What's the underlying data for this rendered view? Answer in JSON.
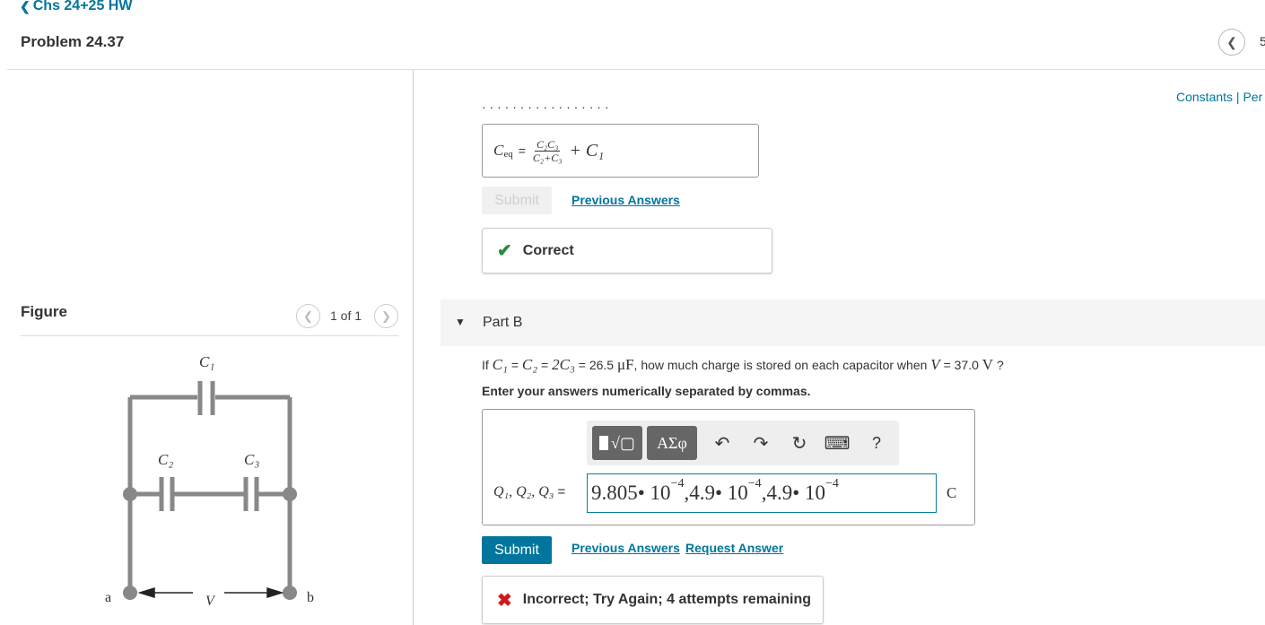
{
  "header": {
    "back_label": "Chs 24+25 HW",
    "problem_title": "Problem 24.37",
    "nav_next_partial": "5"
  },
  "constants": {
    "label": "Constants | Per"
  },
  "part_a": {
    "cut_text": "·  ·  ·  ·     ·  ·     ·  ·     ·  ·  ·  ·  ·  ·  ·  ·  ·",
    "ceq_symbol": "C",
    "ceq_sub": "eq",
    "equals": "=",
    "frac_num": "C₂C₃",
    "frac_den": "C₂+C₃",
    "plus_term": "+ C₁",
    "submit_label": "Submit",
    "previous_answers": "Previous Answers",
    "correct_label": "Correct",
    "colors": {
      "correct": "#2a8a3e"
    }
  },
  "figure": {
    "title": "Figure",
    "count": "1 of 1",
    "labels": {
      "c1": "C₁",
      "c2": "C₂",
      "c3": "C₃",
      "a": "a",
      "b": "b",
      "v": "V"
    }
  },
  "part_b": {
    "title": "Part B",
    "q_prefix": "If",
    "q_c1": "C₁",
    "q_eq1": "=",
    "q_c2": "C₂",
    "q_eq2": "=",
    "q_2c3": "2C₃",
    "q_eq3": "=",
    "q_cap_value": "26.5",
    "q_cap_unit": "μF",
    "q_middle": ", how much charge is stored on each capacitor when",
    "q_v": "V",
    "q_eq4": "=",
    "q_v_value": "37.0",
    "q_v_unit": "V",
    "q_suffix": "?",
    "instructions": "Enter your answers numerically separated by commas.",
    "toolbar": {
      "symbols_label": "ΑΣφ",
      "undo_icon": "↶",
      "redo_icon": "↷",
      "reset_icon": "↻",
      "keyboard_icon": "⌨",
      "help_label": "?"
    },
    "answer_label": "Q₁, Q₂, Q₃",
    "answer_equals": "=",
    "answer": {
      "m1": "9.805",
      "dot1": " • 10",
      "e1": "−4",
      "sep1": ",4.9",
      "dot2": " • 10",
      "e2": "−4",
      "sep2": ",4.9",
      "dot3": " • 10",
      "e3": "−4"
    },
    "unit": "C",
    "submit_label": "Submit",
    "previous_answers": "Previous Answers",
    "request_answer": "Request Answer",
    "feedback": "Incorrect; Try Again; 4 attempts remaining",
    "colors": {
      "submit": "#00759e",
      "incorrect": "#d0181a"
    }
  }
}
